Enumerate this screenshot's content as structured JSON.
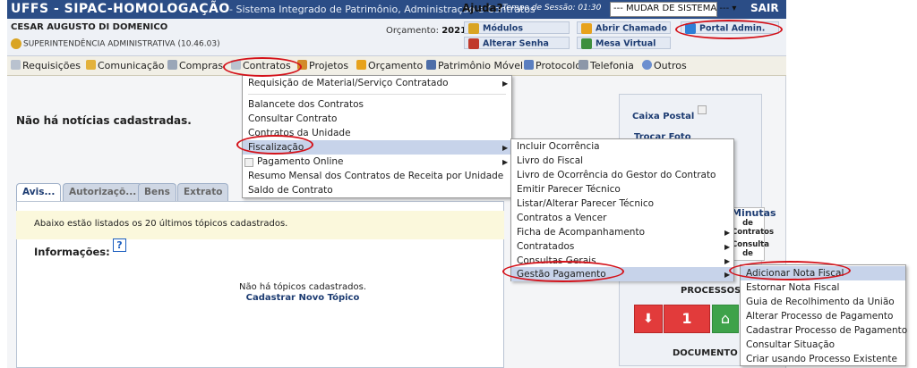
{
  "topbar": {
    "brand": "UFFS - SIPAC-HOMOLOGAÇÃO",
    "subtitle": "- Sistema Integrado de Patrimônio, Administração e Contratos",
    "help": "Ajuda?",
    "session": "Tempo de Sessão: 01:30",
    "system_select": "--- MUDAR DE SISTEMA ---",
    "exit": "SAIR"
  },
  "user": {
    "name": "CESAR AUGUSTO DI DOMENICO",
    "unit": "SUPERINTENDÊNCIA ADMINISTRATIVA (10.46.03)",
    "budget_label": "Orçamento:",
    "budget_year": "2021"
  },
  "quick_links": {
    "modulos": "Módulos",
    "abrir_chamado": "Abrir Chamado",
    "portal_admin": "Portal Admin.",
    "alterar_senha": "Alterar Senha",
    "mesa_virtual": "Mesa Virtual"
  },
  "menubar": {
    "items": [
      "Requisições",
      "Comunicação",
      "Compras",
      "Contratos",
      "Projetos",
      "Orçamento",
      "Patrimônio Móvel",
      "Protocolo",
      "Telefonia",
      "Outros"
    ]
  },
  "main": {
    "no_news": "Não há notícias cadastradas."
  },
  "tabs": [
    "Avis...",
    "Autorizaçõ...",
    "Bens",
    "Extrato"
  ],
  "panel": {
    "notice": "Abaixo estão listados os 20 últimos tópicos cadastrados.",
    "info_label": "Informações:",
    "info_icon": "?",
    "no_topics": "Não há tópicos cadastrados.",
    "new_topic": "Cadastrar Novo Tópico"
  },
  "side": {
    "caixa_postal": "Caixa Postal",
    "trocar_foto": "Trocar Foto",
    "minutas_title": "Minutas",
    "minutas_de": "de",
    "minutas_contratos": "Contratos",
    "consulta": "Consulta",
    "de": "de",
    "processos": "PROCESSOS",
    "process_count": "1",
    "documentos": "DOCUMENTO"
  },
  "contratos_menu": {
    "items": [
      "Requisição de Material/Serviço Contratado",
      "Balancete dos Contratos",
      "Consultar Contrato",
      "Contratos da Unidade",
      "Fiscalização",
      "Pagamento Online",
      "Resumo Mensal dos Contratos de Receita por Unidade",
      "Saldo de Contrato"
    ]
  },
  "fiscalizacao_menu": {
    "items": [
      "Incluir Ocorrência",
      "Livro do Fiscal",
      "Livro de Ocorrência do Gestor do Contrato",
      "Emitir Parecer Técnico",
      "Listar/Alterar Parecer Técnico",
      "Contratos a Vencer",
      "Ficha de Acompanhamento",
      "Contratados",
      "Consultas Gerais",
      "Gestão Pagamento"
    ]
  },
  "gestao_menu": {
    "items": [
      "Adicionar Nota Fiscal",
      "Estornar Nota Fiscal",
      "Guia de Recolhimento da União",
      "Alterar Processo de Pagamento",
      "Cadastrar Processo de Pagamento",
      "Consultar Situação",
      "Criar usando Processo Existente"
    ]
  },
  "colors": {
    "topbar": "#2b4d86",
    "highlight": "#c7d3ea",
    "annotation_circle": "#d4121a",
    "red_button": "#e23b3b",
    "green_button": "#3ea24a"
  }
}
